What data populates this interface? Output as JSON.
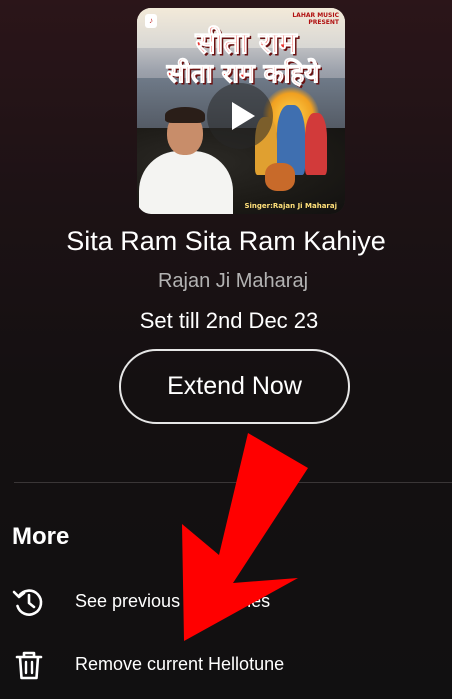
{
  "player": {
    "album_art": {
      "title_line_1": "सीता राम",
      "title_line_2": "सीता राम कहिये",
      "label": "LAHAR MUSIC",
      "label_sub": "PRESENT",
      "singer_credit": "Singer:Rajan Ji Maharaj",
      "play_icon": "play-icon"
    },
    "song_title": "Sita Ram Sita Ram Kahiye",
    "artist": "Rajan Ji Maharaj",
    "set_till": "Set till 2nd Dec 23",
    "extend_label": "Extend Now"
  },
  "more": {
    "heading": "More",
    "items": [
      {
        "icon": "history-icon",
        "label": "See previous Hellotunes"
      },
      {
        "icon": "trash-icon",
        "label": "Remove current Hellotune"
      }
    ]
  },
  "overlay": {
    "arrow_color": "#ff0000",
    "arrow_icon": "red-arrow-annotation"
  },
  "colors": {
    "background_top": "#2b1519",
    "background": "#111011",
    "secondary_text": "#b3b3b3"
  }
}
